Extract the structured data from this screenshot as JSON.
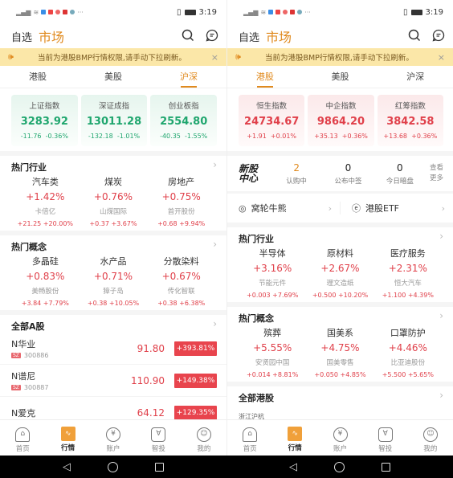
{
  "status_bar": {
    "time": "3:19",
    "signal": "4G",
    "more": "···"
  },
  "header": {
    "watchlist": "自选",
    "market": "市场"
  },
  "notice": {
    "text": "当前为港股BMP行情权限,请手动下拉刷新。",
    "close": "×"
  },
  "tabs": [
    {
      "label": "港股"
    },
    {
      "label": "美股"
    },
    {
      "label": "沪深"
    }
  ],
  "left": {
    "active_tab": "沪深",
    "indices": [
      {
        "name": "上证指数",
        "value": "3283.92",
        "change": "-11.76",
        "pct": "-0.36%"
      },
      {
        "name": "深证成指",
        "value": "13011.28",
        "change": "-132.18",
        "pct": "-1.01%"
      },
      {
        "name": "创业板指",
        "value": "2554.80",
        "change": "-40.35",
        "pct": "-1.55%"
      }
    ],
    "hot_industry": {
      "title": "热门行业",
      "items": [
        {
          "name": "汽车类",
          "pct": "+1.42%",
          "stock": "卡倍亿",
          "change": "+21.25 +20.00%"
        },
        {
          "name": "煤炭",
          "pct": "+0.76%",
          "stock": "山煤国际",
          "change": "+0.37 +3.67%"
        },
        {
          "name": "房地产",
          "pct": "+0.75%",
          "stock": "首开股份",
          "change": "+0.68 +9.94%"
        }
      ]
    },
    "hot_concept": {
      "title": "热门概念",
      "items": [
        {
          "name": "多晶硅",
          "pct": "+0.83%",
          "stock": "美畅股份",
          "change": "+3.84 +7.79%"
        },
        {
          "name": "水产品",
          "pct": "+0.71%",
          "stock": "獐子岛",
          "change": "+0.38 +10.05%"
        },
        {
          "name": "分散染料",
          "pct": "+0.67%",
          "stock": "传化智联",
          "change": "+0.38 +6.38%"
        }
      ]
    },
    "all_a": {
      "title": "全部A股",
      "rows": [
        {
          "name": "N华业",
          "market": "SZ",
          "code": "300886",
          "price": "91.80",
          "pct": "+393.81%"
        },
        {
          "name": "N谱尼",
          "market": "SZ",
          "code": "300887",
          "price": "110.90",
          "pct": "+149.38%"
        },
        {
          "name": "N爱克",
          "market": "",
          "code": "",
          "price": "64.12",
          "pct": "+129.35%"
        }
      ]
    }
  },
  "right": {
    "active_tab": "港股",
    "indices": [
      {
        "name": "恒生指数",
        "value": "24734.67",
        "change": "+1.91",
        "pct": "+0.01%"
      },
      {
        "name": "中企指数",
        "value": "9864.20",
        "change": "+35.13",
        "pct": "+0.36%"
      },
      {
        "name": "红筹指数",
        "value": "3842.58",
        "change": "+13.68",
        "pct": "+0.36%"
      }
    ],
    "ipo": {
      "logo_line1": "新股",
      "logo_line2": "中心",
      "stats": [
        {
          "value": "2",
          "label": "认购中"
        },
        {
          "value": "0",
          "label": "公布中签"
        },
        {
          "value": "0",
          "label": "今日暗盘"
        }
      ],
      "more_line1": "查看",
      "more_line2": "更多"
    },
    "links": [
      {
        "label": "窝轮牛熊"
      },
      {
        "label": "港股ETF"
      }
    ],
    "hot_industry": {
      "title": "热门行业",
      "items": [
        {
          "name": "半导体",
          "pct": "+3.16%",
          "stock": "节能元件",
          "change": "+0.003 +7.69%"
        },
        {
          "name": "原材料",
          "pct": "+2.67%",
          "stock": "理文造纸",
          "change": "+0.500 +10.20%"
        },
        {
          "name": "医疗服务",
          "pct": "+2.31%",
          "stock": "恒大汽车",
          "change": "+1.100 +4.39%"
        }
      ]
    },
    "hot_concept": {
      "title": "热门概念",
      "items": [
        {
          "name": "殡葬",
          "pct": "+5.55%",
          "stock": "安贤园中国",
          "change": "+0.014 +8.81%"
        },
        {
          "name": "国美系",
          "pct": "+4.75%",
          "stock": "国美零售",
          "change": "+0.050 +4.85%"
        },
        {
          "name": "口罩防护",
          "pct": "+4.46%",
          "stock": "比亚迪股份",
          "change": "+5.500 +5.65%"
        }
      ]
    },
    "all_hk": {
      "title": "全部港股",
      "first_row_name": "浙江沪杭"
    }
  },
  "bottom_nav": [
    {
      "label": "首页",
      "icon": "home-icon"
    },
    {
      "label": "行情",
      "icon": "chart-icon"
    },
    {
      "label": "账户",
      "icon": "yuan-icon"
    },
    {
      "label": "智投",
      "icon": "shield-icon"
    },
    {
      "label": "我的",
      "icon": "user-icon"
    }
  ],
  "colors": {
    "accent": "#e08a1e",
    "up": "#e0404a",
    "down": "#1fa66e",
    "notice_bg": "#fbe7a8"
  }
}
